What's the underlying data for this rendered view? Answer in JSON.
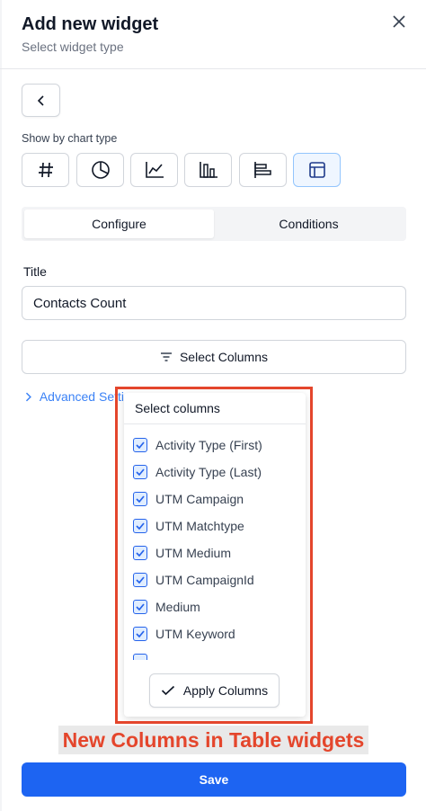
{
  "header": {
    "title": "Add new widget",
    "subtitle": "Select widget type"
  },
  "chart_type": {
    "label": "Show by chart type",
    "buttons": [
      {
        "icon": "hash-icon",
        "active": false
      },
      {
        "icon": "pie-chart-icon",
        "active": false
      },
      {
        "icon": "line-chart-icon",
        "active": false
      },
      {
        "icon": "bar-chart-icon",
        "active": false
      },
      {
        "icon": "horizontal-bar-chart-icon",
        "active": false
      },
      {
        "icon": "table-icon",
        "active": true
      }
    ]
  },
  "tabs": [
    {
      "label": "Configure",
      "active": true
    },
    {
      "label": "Conditions",
      "active": false
    }
  ],
  "form": {
    "title_label": "Title",
    "title_value": "Contacts Count",
    "select_columns_label": "Select Columns",
    "advanced_label": "Advanced Setti"
  },
  "dropdown": {
    "header": "Select columns",
    "items": [
      {
        "label": "Activity Type (First)",
        "checked": true
      },
      {
        "label": "Activity Type (Last)",
        "checked": true
      },
      {
        "label": "UTM Campaign",
        "checked": true
      },
      {
        "label": "UTM Matchtype",
        "checked": true
      },
      {
        "label": "UTM Medium",
        "checked": true
      },
      {
        "label": "UTM CampaignId",
        "checked": true
      },
      {
        "label": "Medium",
        "checked": true
      },
      {
        "label": "UTM Keyword",
        "checked": true
      }
    ],
    "apply_label": "Apply Columns"
  },
  "annotation": "New Columns in Table widgets",
  "save_label": "Save",
  "colors": {
    "accent": "#1d64f2",
    "link": "#3b82f6",
    "highlight": "#e4462c"
  }
}
